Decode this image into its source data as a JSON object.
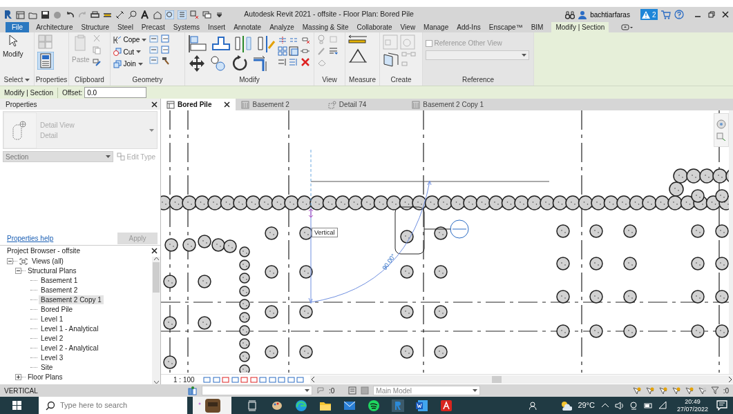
{
  "window": {
    "title": "Autodesk Revit 2021 - offsite - Floor Plan: Bored Pile",
    "user": "bachtiarfaras",
    "alerts": "2"
  },
  "ribbon_tabs": [
    {
      "label": "File",
      "kind": "file",
      "selected": false
    },
    {
      "label": "Architecture",
      "kind": "tab",
      "selected": false
    },
    {
      "label": "Structure",
      "kind": "tab",
      "selected": false
    },
    {
      "label": "Steel",
      "kind": "tab",
      "selected": false
    },
    {
      "label": "Precast",
      "kind": "tab",
      "selected": false
    },
    {
      "label": "Systems",
      "kind": "tab",
      "selected": false
    },
    {
      "label": "Insert",
      "kind": "tab",
      "selected": false
    },
    {
      "label": "Annotate",
      "kind": "tab",
      "selected": false
    },
    {
      "label": "Analyze",
      "kind": "tab",
      "selected": false
    },
    {
      "label": "Massing & Site",
      "kind": "tab",
      "selected": false
    },
    {
      "label": "Collaborate",
      "kind": "tab",
      "selected": false
    },
    {
      "label": "View",
      "kind": "tab",
      "selected": false
    },
    {
      "label": "Manage",
      "kind": "tab",
      "selected": false
    },
    {
      "label": "Add-Ins",
      "kind": "tab",
      "selected": false
    },
    {
      "label": "Enscape™",
      "kind": "tab",
      "selected": false
    },
    {
      "label": "BIM",
      "kind": "tab",
      "selected": false
    },
    {
      "label": "Modify | Section",
      "kind": "context",
      "selected": true
    }
  ],
  "ribbon": {
    "modify_label": "Modify",
    "paste_label": "Paste",
    "geometry_tools": [
      "Cope",
      "Cut",
      "Join"
    ],
    "panels": [
      "Select",
      "Properties",
      "Clipboard",
      "Geometry",
      "Modify",
      "View",
      "Measure",
      "Create",
      "Reference"
    ],
    "reference_checkbox": {
      "label": "Reference Other View",
      "checked": false
    }
  },
  "options_bar": {
    "context": "Modify | Section",
    "offset_label": "Offset:",
    "offset_value": "0.0"
  },
  "properties": {
    "title": "Properties",
    "type_name": "Detail View",
    "type_sub": "Detail",
    "selector": "Section",
    "edit_type": "Edit Type",
    "help": "Properties help",
    "apply": "Apply"
  },
  "project_browser": {
    "title": "Project Browser - offsite",
    "tree": [
      {
        "label": "Views (all)",
        "expanded": true,
        "selected": false,
        "children": [
          {
            "label": "Structural Plans",
            "expanded": true,
            "selected": false,
            "children": [
              {
                "label": "Basement 1",
                "selected": false
              },
              {
                "label": "Basement 2",
                "selected": false
              },
              {
                "label": "Basement 2 Copy 1",
                "selected": true
              },
              {
                "label": "Bored Pile",
                "selected": false
              },
              {
                "label": "Level 1",
                "selected": false
              },
              {
                "label": "Level 1 - Analytical",
                "selected": false
              },
              {
                "label": "Level 2",
                "selected": false
              },
              {
                "label": "Level 2 - Analytical",
                "selected": false
              },
              {
                "label": "Level 3",
                "selected": false
              },
              {
                "label": "Site",
                "selected": false
              }
            ]
          },
          {
            "label": "Floor Plans",
            "expanded": false,
            "selected": false
          }
        ]
      }
    ]
  },
  "view_tabs": [
    {
      "label": "Bored Pile",
      "selected": true
    },
    {
      "label": "Basement 2",
      "selected": false
    },
    {
      "label": "Detail 74",
      "selected": false
    },
    {
      "label": "Basement 2 Copy 1",
      "selected": false
    }
  ],
  "canvas": {
    "tooltip": "Vertical",
    "angle": "90.00°"
  },
  "view_bar": {
    "scale": "1 : 100"
  },
  "status_bar": {
    "message": "VERTICAL",
    "worksets": ":0",
    "model": "Main Model",
    "filter": ":0"
  },
  "taskbar": {
    "search_placeholder": "Type here to search",
    "temperature": "29°C",
    "time": "20:49",
    "date": "27/07/2022"
  }
}
